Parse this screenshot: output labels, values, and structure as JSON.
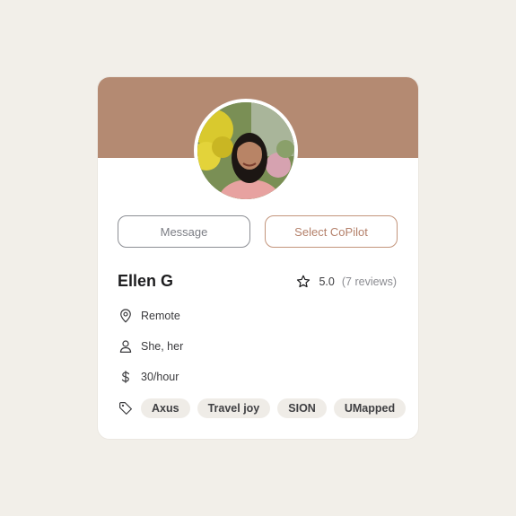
{
  "profile": {
    "name": "Ellen G",
    "rating": "5.0",
    "reviews": "(7 reviews)",
    "location": "Remote",
    "pronouns": "She, her",
    "rate": "30/hour",
    "tags": [
      "Axus",
      "Travel joy",
      "SION",
      "UMapped"
    ]
  },
  "actions": {
    "message_label": "Message",
    "copilot_label": "Select CoPilot"
  },
  "icons": {
    "rating": "star-icon",
    "location": "map-pin-icon",
    "pronouns": "user-icon",
    "rate": "dollar-icon",
    "tags": "tag-icon"
  },
  "colors": {
    "banner": "#b48a72",
    "accent": "#b4806a",
    "background": "#f2efe9",
    "tag_bg": "#efece7"
  }
}
